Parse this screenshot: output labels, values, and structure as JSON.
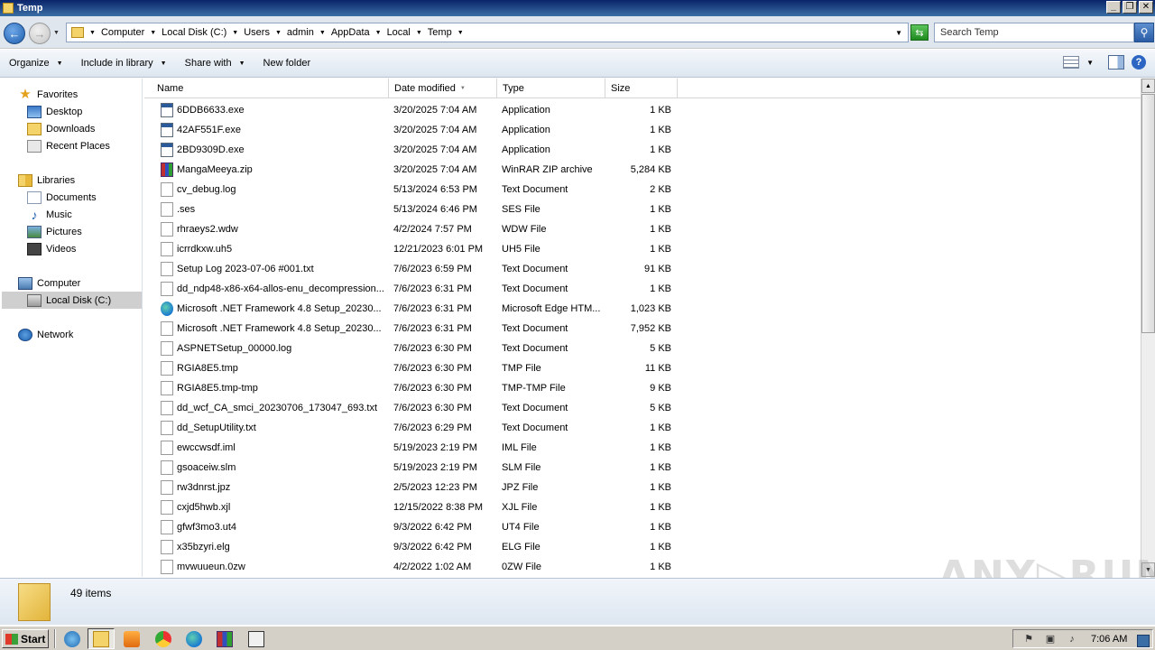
{
  "window": {
    "title": "Temp"
  },
  "window_buttons": {
    "minimize": "_",
    "restore": "❐",
    "close": "✕"
  },
  "address": {
    "crumbs": [
      "Computer",
      "Local Disk (C:)",
      "Users",
      "admin",
      "AppData",
      "Local",
      "Temp"
    ]
  },
  "search": {
    "placeholder": "Search Temp"
  },
  "toolbar": {
    "organize": "Organize",
    "include_in_library": "Include in library",
    "share_with": "Share with",
    "new_folder": "New folder"
  },
  "nav": {
    "favorites": "Favorites",
    "desktop": "Desktop",
    "downloads": "Downloads",
    "recent_places": "Recent Places",
    "libraries": "Libraries",
    "documents": "Documents",
    "music": "Music",
    "pictures": "Pictures",
    "videos": "Videos",
    "computer": "Computer",
    "local_disk": "Local Disk (C:)",
    "network": "Network"
  },
  "columns": {
    "name": "Name",
    "date": "Date modified",
    "type": "Type",
    "size": "Size"
  },
  "files": [
    {
      "name": "6DDB6633.exe",
      "date": "3/20/2025 7:04 AM",
      "type": "Application",
      "size": "1 KB",
      "icon": "exe"
    },
    {
      "name": "42AF551F.exe",
      "date": "3/20/2025 7:04 AM",
      "type": "Application",
      "size": "1 KB",
      "icon": "exe"
    },
    {
      "name": "2BD9309D.exe",
      "date": "3/20/2025 7:04 AM",
      "type": "Application",
      "size": "1 KB",
      "icon": "exe"
    },
    {
      "name": "MangaMeeya.zip",
      "date": "3/20/2025 7:04 AM",
      "type": "WinRAR ZIP archive",
      "size": "5,284 KB",
      "icon": "zip"
    },
    {
      "name": "cv_debug.log",
      "date": "5/13/2024 6:53 PM",
      "type": "Text Document",
      "size": "2 KB",
      "icon": "doc"
    },
    {
      "name": ".ses",
      "date": "5/13/2024 6:46 PM",
      "type": "SES File",
      "size": "1 KB",
      "icon": "doc"
    },
    {
      "name": "rhraeys2.wdw",
      "date": "4/2/2024 7:57 PM",
      "type": "WDW File",
      "size": "1 KB",
      "icon": "doc"
    },
    {
      "name": "icrrdkxw.uh5",
      "date": "12/21/2023 6:01 PM",
      "type": "UH5 File",
      "size": "1 KB",
      "icon": "doc"
    },
    {
      "name": "Setup Log 2023-07-06 #001.txt",
      "date": "7/6/2023 6:59 PM",
      "type": "Text Document",
      "size": "91 KB",
      "icon": "doc"
    },
    {
      "name": "dd_ndp48-x86-x64-allos-enu_decompression...",
      "date": "7/6/2023 6:31 PM",
      "type": "Text Document",
      "size": "1 KB",
      "icon": "doc"
    },
    {
      "name": "Microsoft .NET Framework 4.8 Setup_20230...",
      "date": "7/6/2023 6:31 PM",
      "type": "Microsoft Edge HTM...",
      "size": "1,023 KB",
      "icon": "edge"
    },
    {
      "name": "Microsoft .NET Framework 4.8 Setup_20230...",
      "date": "7/6/2023 6:31 PM",
      "type": "Text Document",
      "size": "7,952 KB",
      "icon": "doc"
    },
    {
      "name": "ASPNETSetup_00000.log",
      "date": "7/6/2023 6:30 PM",
      "type": "Text Document",
      "size": "5 KB",
      "icon": "doc"
    },
    {
      "name": "RGIA8E5.tmp",
      "date": "7/6/2023 6:30 PM",
      "type": "TMP File",
      "size": "11 KB",
      "icon": "doc"
    },
    {
      "name": "RGIA8E5.tmp-tmp",
      "date": "7/6/2023 6:30 PM",
      "type": "TMP-TMP File",
      "size": "9 KB",
      "icon": "doc"
    },
    {
      "name": "dd_wcf_CA_smci_20230706_173047_693.txt",
      "date": "7/6/2023 6:30 PM",
      "type": "Text Document",
      "size": "5 KB",
      "icon": "doc"
    },
    {
      "name": "dd_SetupUtility.txt",
      "date": "7/6/2023 6:29 PM",
      "type": "Text Document",
      "size": "1 KB",
      "icon": "doc"
    },
    {
      "name": "ewccwsdf.iml",
      "date": "5/19/2023 2:19 PM",
      "type": "IML File",
      "size": "1 KB",
      "icon": "doc"
    },
    {
      "name": "gsoaceiw.slm",
      "date": "5/19/2023 2:19 PM",
      "type": "SLM File",
      "size": "1 KB",
      "icon": "doc"
    },
    {
      "name": "rw3dnrst.jpz",
      "date": "2/5/2023 12:23 PM",
      "type": "JPZ File",
      "size": "1 KB",
      "icon": "doc"
    },
    {
      "name": "cxjd5hwb.xjl",
      "date": "12/15/2022 8:38 PM",
      "type": "XJL File",
      "size": "1 KB",
      "icon": "doc"
    },
    {
      "name": "gfwf3mo3.ut4",
      "date": "9/3/2022 6:42 PM",
      "type": "UT4 File",
      "size": "1 KB",
      "icon": "doc"
    },
    {
      "name": "x35bzyri.elg",
      "date": "9/3/2022 6:42 PM",
      "type": "ELG File",
      "size": "1 KB",
      "icon": "doc"
    },
    {
      "name": "mvwuueun.0zw",
      "date": "4/2/2022 1:02 AM",
      "type": "0ZW File",
      "size": "1 KB",
      "icon": "doc"
    }
  ],
  "details": {
    "item_count": "49 items"
  },
  "watermark": "ANY▷RUN",
  "taskbar": {
    "start": "Start",
    "clock": "7:06 AM"
  }
}
